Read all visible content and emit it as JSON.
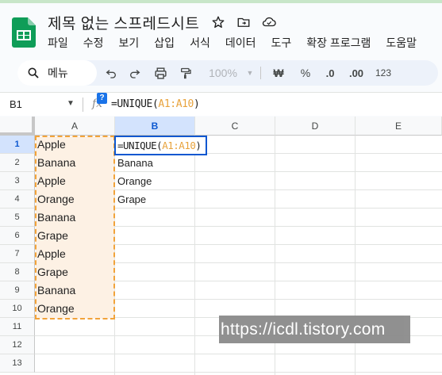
{
  "app": {
    "title": "제목 없는 스프레드시트",
    "menu": [
      "파일",
      "수정",
      "보기",
      "삽입",
      "서식",
      "데이터",
      "도구",
      "확장 프로그램",
      "도움말"
    ]
  },
  "toolbar": {
    "search_label": "메뉴",
    "zoom": "100%",
    "currency": "₩",
    "percent": "%",
    "decrease_decimal": ".0",
    "increase_decimal": ".00",
    "number_format": "123"
  },
  "formula_bar": {
    "cell_ref": "B1",
    "fx": "fx",
    "help_badge": "?",
    "formula_prefix": "=UNIQUE(",
    "formula_range": "A1:A10",
    "formula_suffix": ")"
  },
  "grid": {
    "columns": [
      "A",
      "B",
      "C",
      "D",
      "E"
    ],
    "rows": [
      "1",
      "2",
      "3",
      "4",
      "5",
      "6",
      "7",
      "8",
      "9",
      "10",
      "11",
      "12",
      "13"
    ],
    "column_a": [
      "Apple",
      "Banana",
      "Apple",
      "Orange",
      "Banana",
      "Grape",
      "Apple",
      "Grape",
      "Banana",
      "Orange"
    ],
    "column_b": [
      "Banana",
      "Orange",
      "Grape"
    ],
    "active_cell": "B1"
  },
  "watermark": "https://icdl.tistory.com",
  "colors": {
    "accent": "#0b57d0",
    "copy_dash": "#f2a33a",
    "range_fill": "#fdf1e4",
    "sheets_green": "#0f9d58"
  }
}
